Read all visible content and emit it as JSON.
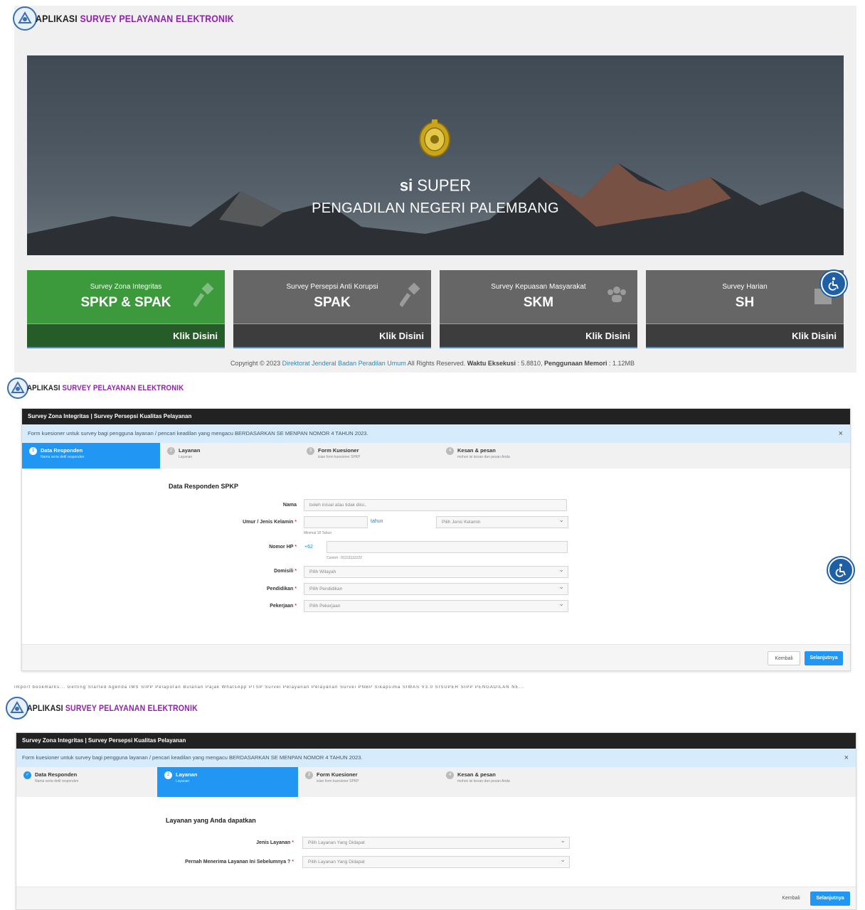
{
  "app": {
    "title_prefix": "A",
    "title_plain": "PLIKASI ",
    "title_highlight": "SURVEY PELAYANAN ELEKTRONIK"
  },
  "hero": {
    "title_bold": "si",
    "title_rest": " SUPER",
    "subtitle": "PENGADILAN NEGERI PALEMBANG"
  },
  "cards": [
    {
      "small": "Survey Zona Integritas",
      "big": "SPKP & SPAK",
      "link": "Klik Disini",
      "icon": "gavel-icon"
    },
    {
      "small": "Survey Persepsi Anti Korupsi",
      "big": "SPAK",
      "link": "Klik Disini",
      "icon": "gavel-icon"
    },
    {
      "small": "Survey Kepuasan Masyarakat",
      "big": "SKM",
      "link": "Klik Disini",
      "icon": "users-icon"
    },
    {
      "small": "Survey Harian",
      "big": "SH",
      "link": "Klik Disini",
      "icon": "calendar-icon"
    }
  ],
  "footer": {
    "pre": "Copyright © 2023 ",
    "link": "Direktorat Jenderal Badan Peradilan Umum",
    "mid": " All Rights Reserved. ",
    "exec_label": "Waktu Eksekusi",
    "exec_value": " : 5.8810, ",
    "mem_label": "Penggunaan Memori",
    "mem_value": " : 1.12MB"
  },
  "form": {
    "header": "Survey Zona Integritas | Survey Persepsi Kualitas Pelayanan",
    "alert": "Form kuesioner untuk survey bagi pengguna layanan / pencari keadilan yang mengacu BERDASARKAN SE MENPAN NOMOR 4 TAHUN 2023.",
    "close": "×",
    "steps": [
      {
        "num": "1",
        "title": "Data Responden",
        "sub": "Nama serta detil responden"
      },
      {
        "num": "2",
        "title": "Layanan",
        "sub": "Layanan"
      },
      {
        "num": "3",
        "title": "Form Kuesioner",
        "sub": "isian form kuesioner SPKP"
      },
      {
        "num": "4",
        "title": "Kesan & pesan",
        "sub": "mohon isi kesan dan pesan Anda"
      }
    ],
    "back": "Kembali",
    "next": "Selanjutnya"
  },
  "step1": {
    "title": "Data Responden SPKP",
    "nama_label": "Nama",
    "nama_placeholder": "boleh inisial atau tidak diisi..",
    "umur_label": "Umur / Jenis Kelamin",
    "umur_unit": "tahun",
    "umur_hint": "Minimal 18 Tahun",
    "gender_placeholder": "Pilih Jenis Kelamin",
    "hp_label": "Nomor HP",
    "hp_prefix": "+62",
    "hp_hint": "Contoh : 81211112222",
    "domisili_label": "Domisili",
    "domisili_placeholder": "Pilih Wilayah",
    "pendidikan_label": "Pendidikan",
    "pendidikan_placeholder": "Pilih Pendidikan",
    "pekerjaan_label": "Pekerjaan",
    "pekerjaan_placeholder": "Pilih Pekerjaan",
    "required_mark": "*"
  },
  "step2": {
    "title": "Layanan yang Anda dapatkan",
    "jenis_label": "Jenis Layanan",
    "jenis_placeholder": "Pilih Layanan Yang Didapat",
    "pernah_label": "Pernah Menerima Layanan Ini Sebelumnya ?",
    "pernah_placeholder": "Pilih Layanan Yang Didapat"
  },
  "bookmarks": "Import bookmarks...   Getting Started   Agenda   IMS   SIPP   Pelaporan Bulanan   Pajak   WhatsApp   PTSP   Survei Pelayanan   Pelayanan Survei   PNBP   Sikapsima   SIWAS V3.0   SISUPER   SIPP PENGADILAN NE..."
}
